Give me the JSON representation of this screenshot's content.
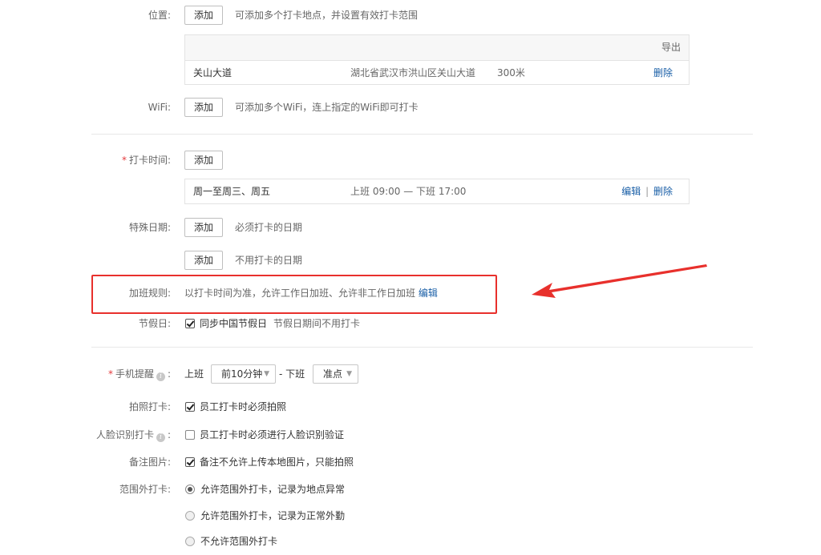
{
  "location": {
    "label": "位置:",
    "add_label": "添加",
    "hint": "可添加多个打卡地点，并设置有效打卡范围",
    "export_label": "导出",
    "rows": [
      {
        "name": "关山大道",
        "address": "湖北省武汉市洪山区关山大道",
        "range": "300米",
        "delete_label": "删除"
      }
    ]
  },
  "wifi": {
    "label": "WiFi:",
    "add_label": "添加",
    "hint": "可添加多个WiFi，连上指定的WiFi即可打卡"
  },
  "punch_time": {
    "required_mark": "*",
    "label": "打卡时间:",
    "add_label": "添加",
    "rows": [
      {
        "days": "周一至周三、周五",
        "time": "上班 09:00  — 下班 17:00",
        "edit_label": "编辑",
        "sep": "|",
        "delete_label": "删除"
      }
    ]
  },
  "special_dates": {
    "label": "特殊日期:",
    "add_label_1": "添加",
    "hint_1": "必须打卡的日期",
    "add_label_2": "添加",
    "hint_2": "不用打卡的日期"
  },
  "overtime": {
    "label": "加班规则:",
    "text": "以打卡时间为准，允许工作日加班、允许非工作日加班",
    "edit_label": "编辑"
  },
  "holiday": {
    "label": "节假日:",
    "checked": true,
    "option": "同步中国节假日",
    "hint": "节假日期间不用打卡"
  },
  "reminder": {
    "required_mark": "*",
    "label": "手机提醒",
    "info_icon": "i",
    "colon": ":",
    "on_label": "上班",
    "on_value": "前10分钟",
    "dash": "- 下班",
    "off_value": "准点"
  },
  "photo": {
    "label": "拍照打卡:",
    "checked": true,
    "option": "员工打卡时必须拍照"
  },
  "face": {
    "label": "人脸识别打卡",
    "info_icon": "i",
    "colon": ":",
    "checked": false,
    "option": "员工打卡时必须进行人脸识别验证"
  },
  "remark_photo": {
    "label": "备注图片:",
    "checked": true,
    "option": "备注不允许上传本地图片，只能拍照"
  },
  "out_of_range": {
    "label": "范围外打卡:",
    "options": [
      {
        "text": "允许范围外打卡，记录为地点异常",
        "checked": true
      },
      {
        "text": "允许范围外打卡，记录为正常外勤",
        "checked": false
      },
      {
        "text": "不允许范围外打卡",
        "checked": false
      }
    ]
  },
  "colors": {
    "link": "#1a5fa7",
    "required": "#e4393c",
    "highlight": "#e8302c"
  }
}
